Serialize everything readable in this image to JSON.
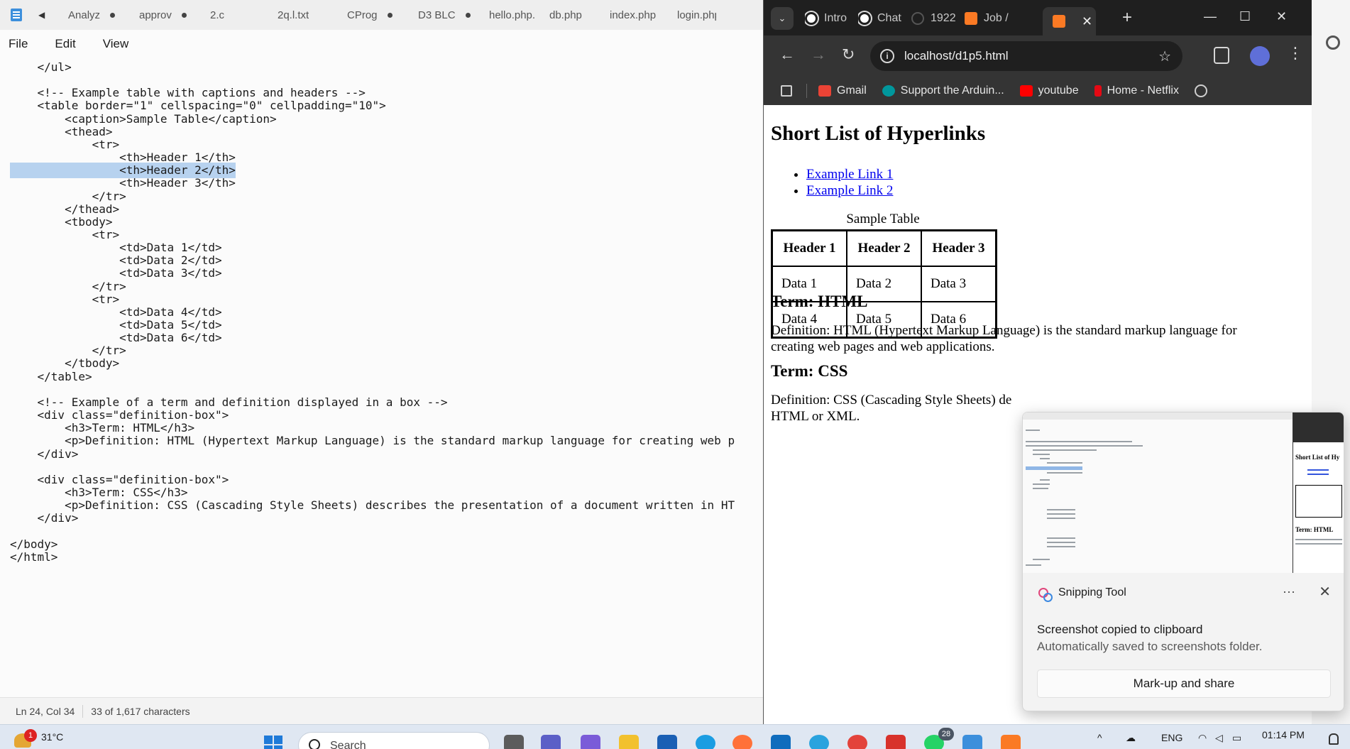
{
  "notepad": {
    "tabs": [
      {
        "name": "Analyz",
        "modified": true
      },
      {
        "name": "approv",
        "modified": true
      },
      {
        "name": "2.c",
        "modified": false
      },
      {
        "name": "2q.l.txt",
        "modified": false
      },
      {
        "name": "CProg",
        "modified": true
      },
      {
        "name": "D3 BLC",
        "modified": true
      },
      {
        "name": "hello.php.txt",
        "modified": false
      },
      {
        "name": "db.php",
        "modified": false
      },
      {
        "name": "index.php",
        "modified": false
      },
      {
        "name": "login.php",
        "modified": false
      }
    ],
    "menu": [
      "File",
      "Edit",
      "View"
    ],
    "lines": [
      "    </ul>",
      "",
      "    <!-- Example table with captions and headers -->",
      "    <table border=\"1\" cellspacing=\"0\" cellpadding=\"10\">",
      "        <caption>Sample Table</caption>",
      "        <thead>",
      "            <tr>",
      "                <th>Header 1</th>",
      "                <th>Header 2</th>",
      "                <th>Header 3</th>",
      "            </tr>",
      "        </thead>",
      "        <tbody>",
      "            <tr>",
      "                <td>Data 1</td>",
      "                <td>Data 2</td>",
      "                <td>Data 3</td>",
      "            </tr>",
      "            <tr>",
      "                <td>Data 4</td>",
      "                <td>Data 5</td>",
      "                <td>Data 6</td>",
      "            </tr>",
      "        </tbody>",
      "    </table>",
      "",
      "    <!-- Example of a term and definition displayed in a box -->",
      "    <div class=\"definition-box\">",
      "        <h3>Term: HTML</h3>",
      "        <p>Definition: HTML (Hypertext Markup Language) is the standard markup language for creating web p",
      "    </div>",
      "",
      "    <div class=\"definition-box\">",
      "        <h3>Term: CSS</h3>",
      "        <p>Definition: CSS (Cascading Style Sheets) describes the presentation of a document written in HT",
      "    </div>",
      "",
      "</body>",
      "</html>"
    ],
    "selected_line_index": 8,
    "status": {
      "position": "Ln 24, Col 34",
      "selection": "33 of 1,617 characters"
    }
  },
  "browser": {
    "tabs": [
      {
        "title": "Intro",
        "icon": "openai-icon"
      },
      {
        "title": "Chat",
        "icon": "openai-icon"
      },
      {
        "title": "1922",
        "icon": "github-icon"
      },
      {
        "title": "Job /",
        "icon": "xampp-icon"
      },
      {
        "title": "",
        "icon": "xampp-icon",
        "active": true
      }
    ],
    "url": "localhost/d1p5.html",
    "bookmarks": [
      {
        "label": "Gmail",
        "icon": "gmail-icon"
      },
      {
        "label": "Support the Arduin...",
        "icon": "arduino-icon"
      },
      {
        "label": "youtube",
        "icon": "youtube-icon"
      },
      {
        "label": "Home - Netflix",
        "icon": "netflix-icon"
      }
    ],
    "page": {
      "heading": "Short List of Hyperlinks",
      "links": [
        "Example Link 1",
        "Example Link 2"
      ],
      "table_caption": "Sample Table",
      "table_headers": [
        "Header 1",
        "Header 2",
        "Header 3"
      ],
      "table_rows": [
        [
          "Data 1",
          "Data 2",
          "Data 3"
        ],
        [
          "Data 4",
          "Data 5",
          "Data 6"
        ]
      ],
      "term1": "Term: HTML",
      "def1": "Definition: HTML (Hypertext Markup Language) is the standard markup language for creating web pages and web applications.",
      "term2": "Term: CSS",
      "def2_line1": "Definition: CSS (Cascading Style Sheets) de",
      "def2_line2": "HTML or XML."
    }
  },
  "snipping": {
    "app": "Snipping Tool",
    "title": "Screenshot copied to clipboard",
    "subtitle": "Automatically saved to screenshots folder.",
    "button": "Mark-up and share",
    "thumb_heading": "Short List of Hy",
    "thumb_term": "Term: HTML"
  },
  "taskbar": {
    "weather_temp": "31°C",
    "weather_badge": "1",
    "search_placeholder": "Search",
    "whatsapp_badge": "28",
    "language": "ENG",
    "time": "01:14 PM"
  },
  "colors": {
    "selection": "#b7d2ef",
    "chrome_dark": "#1f1f1f",
    "chrome_toolbar": "#343434",
    "link": "#0000ee"
  }
}
